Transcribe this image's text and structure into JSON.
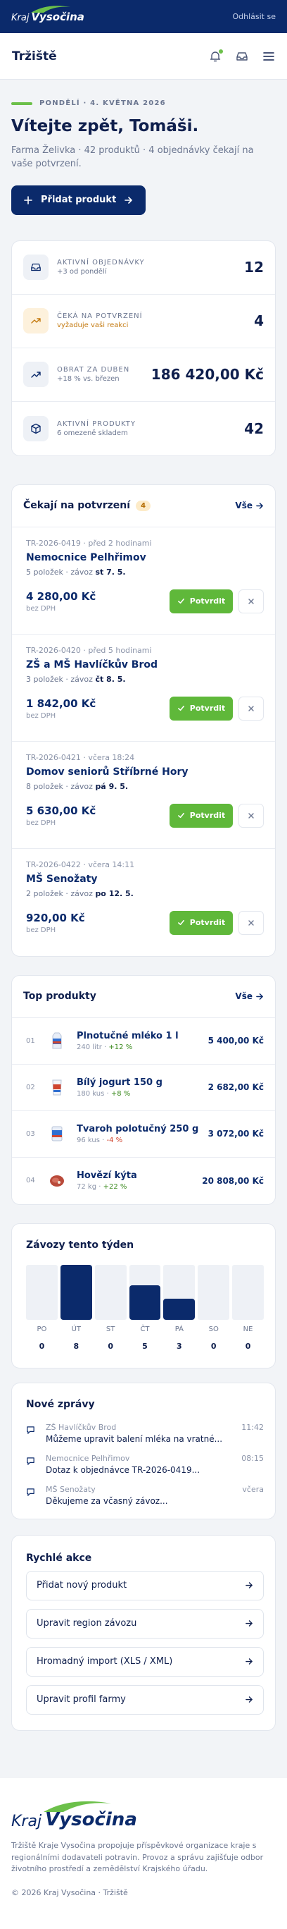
{
  "header": {
    "logo_prefix": "Kraj",
    "logo_name": "Vysočina",
    "logout": "Odhlásit se"
  },
  "appbar": {
    "title": "Tržiště"
  },
  "hero": {
    "date": "Pondělí · 4. května 2026",
    "greeting": "Vítejte zpět, Tomáši.",
    "summary": "Farma Želivka · 42 produktů · 4 objednávky čekají na vaše potvrzení.",
    "add_button": "Přidat produkt"
  },
  "stats": [
    {
      "label": "Aktivní objednávky",
      "sub": "+3 od pondělí",
      "value": "12",
      "icon": "inbox-icon"
    },
    {
      "label": "Čeká na potvrzení",
      "sub": "vyžaduje vaši reakci",
      "value": "4",
      "icon": "trend-icon"
    },
    {
      "label": "Obrat za duben",
      "sub": "+18 % vs. březen",
      "value": "186 420,00 Kč",
      "icon": "trend-up-icon"
    },
    {
      "label": "Aktivní produkty",
      "sub": "6 omezeně skladem",
      "value": "42",
      "icon": "box-icon"
    }
  ],
  "pending": {
    "title": "Čekají na potvrzení",
    "count": "4",
    "all_link": "Vše",
    "confirm_label": "Potvrdit",
    "orders": [
      {
        "id": "TR-2026-0419",
        "time": "před 2 hodinami",
        "name": "Nemocnice Pelhřimov",
        "items": "5 položek · závoz",
        "day": "st 7. 5.",
        "price": "4 280,00 Kč",
        "vat": "bez DPH"
      },
      {
        "id": "TR-2026-0420",
        "time": "před 5 hodinami",
        "name": "ZŠ a MŠ Havlíčkův Brod",
        "items": "3 položek · závoz",
        "day": "čt 8. 5.",
        "price": "1 842,00 Kč",
        "vat": "bez DPH"
      },
      {
        "id": "TR-2026-0421",
        "time": "včera 18:24",
        "name": "Domov seniorů Stříbrné Hory",
        "items": "8 položek · závoz",
        "day": "pá 9. 5.",
        "price": "5 630,00 Kč",
        "vat": "bez DPH"
      },
      {
        "id": "TR-2026-0422",
        "time": "včera 14:11",
        "name": "MŠ Senožaty",
        "items": "2 položek · závoz",
        "day": "po 12. 5.",
        "price": "920,00 Kč",
        "vat": "bez DPH"
      }
    ]
  },
  "top_products": {
    "title": "Top produkty",
    "all_link": "Vše",
    "items": [
      {
        "rank": "01",
        "name": "Plnotučné mléko 1 l",
        "qty": "240 litr",
        "change": "+12 %",
        "trend": "up",
        "revenue": "5 400,00 Kč"
      },
      {
        "rank": "02",
        "name": "Bílý jogurt 150 g",
        "qty": "180 kus",
        "change": "+8 %",
        "trend": "up",
        "revenue": "2 682,00 Kč"
      },
      {
        "rank": "03",
        "name": "Tvaroh polotučný 250 g",
        "qty": "96 kus",
        "change": "-4 %",
        "trend": "down",
        "revenue": "3 072,00 Kč"
      },
      {
        "rank": "04",
        "name": "Hovězí kýta",
        "qty": "72 kg",
        "change": "+22 %",
        "trend": "up",
        "revenue": "20 808,00 Kč"
      }
    ]
  },
  "deliveries": {
    "title": "Závozy tento týden",
    "chart_data": {
      "type": "bar",
      "categories": [
        "PO",
        "ÚT",
        "ST",
        "ČT",
        "PÁ",
        "SO",
        "NE"
      ],
      "values": [
        0,
        8,
        0,
        5,
        3,
        0,
        0
      ],
      "ylim": [
        0,
        8
      ],
      "title": "Závozy tento týden"
    }
  },
  "messages": {
    "title": "Nové zprávy",
    "items": [
      {
        "from": "ZŠ Havlíčkův Brod",
        "time": "11:42",
        "text": "Můžeme upravit balení mléka na vratné..."
      },
      {
        "from": "Nemocnice Pelhřimov",
        "time": "08:15",
        "text": "Dotaz k objednávce TR-2026-0419..."
      },
      {
        "from": "MŠ Senožaty",
        "time": "včera",
        "text": "Děkujeme za včasný závoz..."
      }
    ]
  },
  "quick_actions": {
    "title": "Rychlé akce",
    "items": [
      "Přidat nový produkt",
      "Upravit region závozu",
      "Hromadný import (XLS / XML)",
      "Upravit profil farmy"
    ]
  },
  "footer": {
    "logo_prefix": "Kraj",
    "logo_name": "Vysočina",
    "text": "Tržiště Kraje Vysočina propojuje příspěvkové organizace kraje s regionálními dodavateli potravin. Provoz a správu zajišťuje odbor životního prostředí a zemědělství Krajského úřadu.",
    "copyright": "© 2026 Kraj Vysočina · Tržiště"
  },
  "colors": {
    "brand": "#0b2a6b",
    "accent": "#6cc04a",
    "warning": "#c47a10",
    "negative": "#d0452f"
  }
}
